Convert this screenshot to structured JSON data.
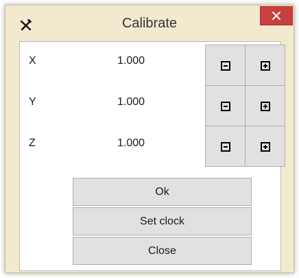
{
  "window": {
    "title": "Calibrate",
    "icon": "tools-icon",
    "close_icon": "close-icon"
  },
  "rows": [
    {
      "label": "X",
      "value": "1.000",
      "decrement_icon": "minus-box-icon",
      "increment_icon": "plus-box-icon"
    },
    {
      "label": "Y",
      "value": "1.000",
      "decrement_icon": "minus-box-icon",
      "increment_icon": "plus-box-icon"
    },
    {
      "label": "Z",
      "value": "1.000",
      "decrement_icon": "minus-box-icon",
      "increment_icon": "plus-box-icon"
    }
  ],
  "buttons": {
    "ok": "Ok",
    "set_clock": "Set clock",
    "close": "Close"
  },
  "colors": {
    "frame": "#f2e9cf",
    "close_button": "#c8403e",
    "button_face": "#e1e1e1"
  }
}
